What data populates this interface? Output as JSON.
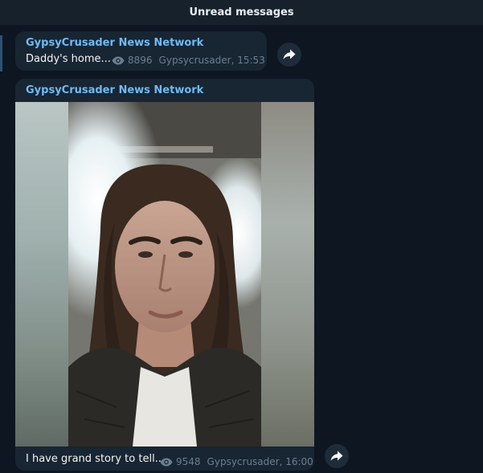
{
  "unread_bar": {
    "label": "Unread messages"
  },
  "messages": [
    {
      "sender": "GypsyCrusader News Network",
      "text": "Daddy's home...",
      "views": "8896",
      "author_time": "Gypsycrusader, 15:53"
    },
    {
      "sender": "GypsyCrusader News Network",
      "text": "I have grand story to tell...",
      "views": "9548",
      "author_time": "Gypsycrusader, 16:00",
      "media": "selfie-photo"
    }
  ],
  "icons": {
    "views": "eye-icon",
    "share": "share-arrow-icon"
  },
  "colors": {
    "background": "#0e1621",
    "bubble": "#182533",
    "sender": "#71baf2",
    "meta": "#6d7f8f",
    "header": "#17212b"
  }
}
